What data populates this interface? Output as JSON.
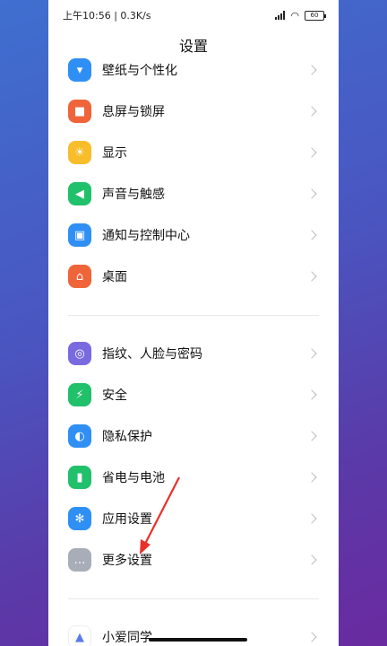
{
  "status": {
    "time": "上午10:56 | 0.3K/s",
    "battery": "60"
  },
  "header": {
    "title": "设置"
  },
  "items": [
    {
      "label": "壁纸与个性化",
      "icon": "wallpaper-icon",
      "color": "#2f8ff5",
      "glyph": "▾"
    },
    {
      "label": "息屏与锁屏",
      "icon": "lock-screen-icon",
      "color": "#f0643a",
      "glyph": "■"
    },
    {
      "label": "显示",
      "icon": "sun-icon",
      "color": "#f7bd2a",
      "glyph": "☀"
    },
    {
      "label": "声音与触感",
      "icon": "speaker-icon",
      "color": "#21c06a",
      "glyph": "◀"
    },
    {
      "label": "通知与控制中心",
      "icon": "notification-icon",
      "color": "#2f8ff5",
      "glyph": "▣"
    },
    {
      "label": "桌面",
      "icon": "home-icon",
      "color": "#f0643a",
      "glyph": "⌂"
    },
    {
      "label": "指纹、人脸与密码",
      "icon": "fingerprint-icon",
      "color": "#7a6ae0",
      "glyph": "◎"
    },
    {
      "label": "安全",
      "icon": "shield-icon",
      "color": "#21c06a",
      "glyph": "⚡"
    },
    {
      "label": "隐私保护",
      "icon": "privacy-icon",
      "color": "#2f8ff5",
      "glyph": "◐"
    },
    {
      "label": "省电与电池",
      "icon": "battery-icon",
      "color": "#21c06a",
      "glyph": "▮"
    },
    {
      "label": "应用设置",
      "icon": "gear-icon",
      "color": "#2f8ff5",
      "glyph": "✻"
    },
    {
      "label": "更多设置",
      "icon": "more-icon",
      "color": "#a8adb8",
      "glyph": "…"
    },
    {
      "label": "小爱同学",
      "icon": "xiaoai-icon",
      "color": "#ffffff",
      "glyph": "▲"
    }
  ]
}
